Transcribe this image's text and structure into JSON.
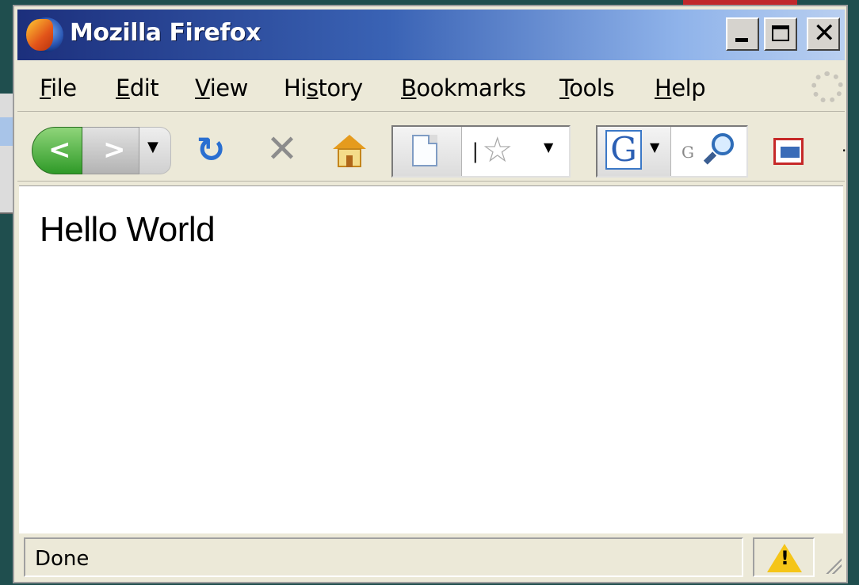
{
  "window": {
    "title": "Mozilla Firefox"
  },
  "menu": {
    "items": [
      {
        "label": "File",
        "accesskey": "F"
      },
      {
        "label": "Edit",
        "accesskey": "E"
      },
      {
        "label": "View",
        "accesskey": "V"
      },
      {
        "label": "History",
        "accesskey": "s"
      },
      {
        "label": "Bookmarks",
        "accesskey": "B"
      },
      {
        "label": "Tools",
        "accesskey": "T"
      },
      {
        "label": "Help",
        "accesskey": "H"
      }
    ]
  },
  "navigation": {
    "back_icon": "back-arrow-icon",
    "forward_icon": "forward-arrow-icon",
    "reload_icon": "reload-icon",
    "stop_icon": "stop-icon",
    "home_icon": "home-icon"
  },
  "address_bar": {
    "value": "",
    "site_icon": "page-icon",
    "bookmark_icon": "star-icon"
  },
  "search_bar": {
    "engine_letter": "G",
    "placeholder": "G",
    "value": ""
  },
  "page": {
    "text": "Hello World"
  },
  "status": {
    "text": "Done",
    "warning_icon": "warning-icon"
  },
  "colors": {
    "title_gradient_start": "#1c2f7c",
    "title_gradient_end": "#b9cff0",
    "back_button": "#2f9a28",
    "reload": "#2a6fd1",
    "chrome": "#ece9d8"
  }
}
